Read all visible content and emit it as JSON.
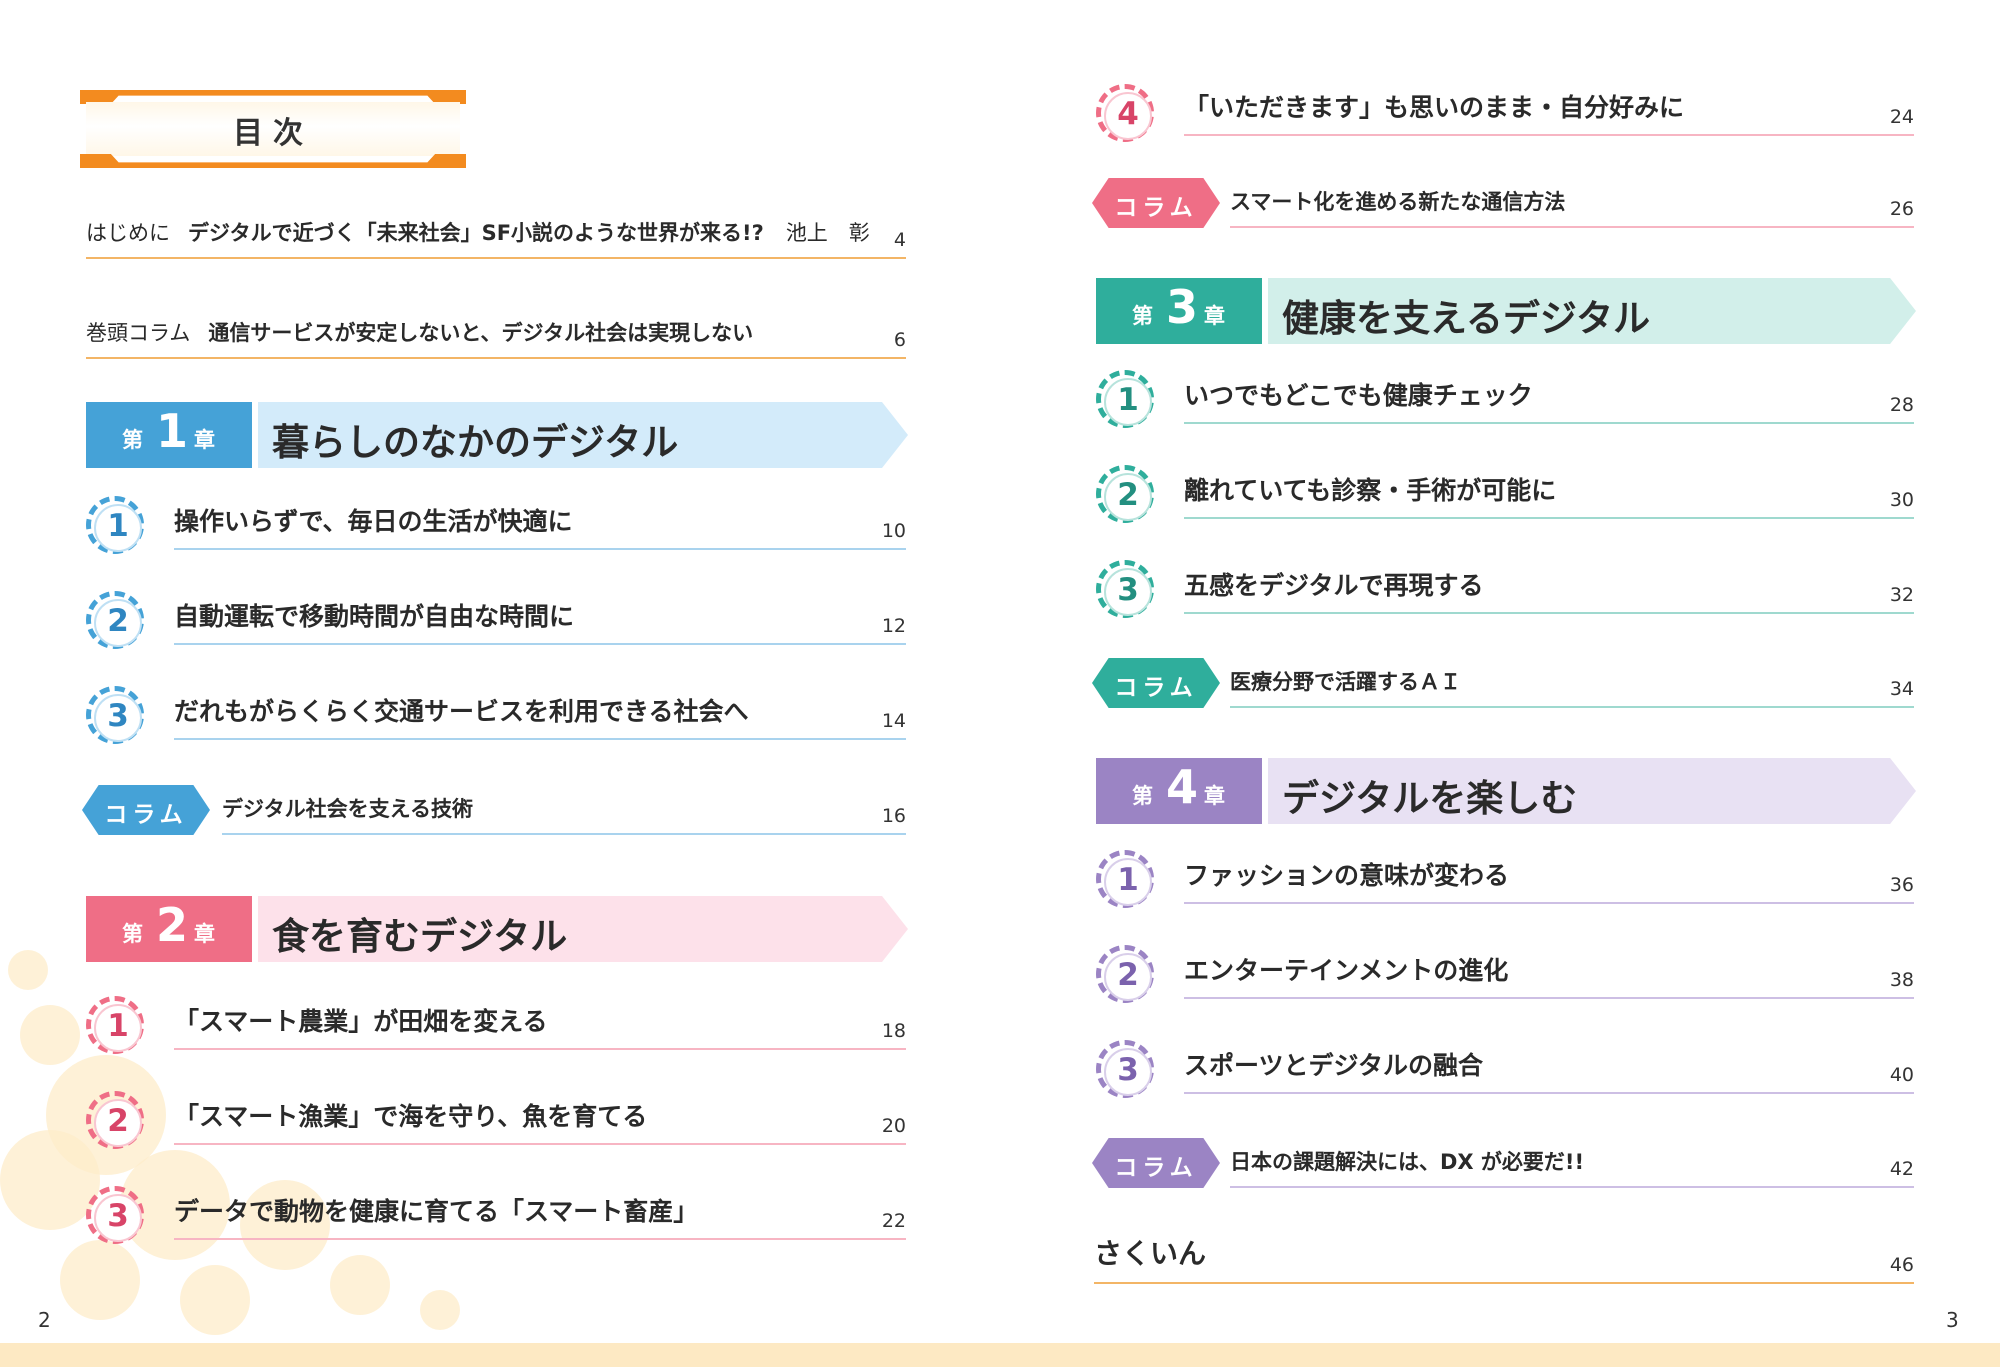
{
  "page": {
    "left_number": "2",
    "right_number": "3"
  },
  "colors": {
    "orange": "#f38b1f",
    "ch1": "#45a2d7",
    "ch1_band": "#d3ebfa",
    "ch2": "#ef6e86",
    "ch2_band": "#fde1ea",
    "ch3": "#2fae9c",
    "ch3_band": "#d2efea",
    "ch4": "#9b84c4",
    "ch4_band": "#e8e1f3",
    "pink_accent": "#d84468"
  },
  "title": "目次",
  "intro": [
    {
      "prefix": "はじめに",
      "text": "デジタルで近づく「未来社会」SF小説のような世界が来る!?",
      "author": "池上　彰",
      "page": "4"
    },
    {
      "prefix": "巻頭コラム",
      "text": "通信サービスが安定しないと、デジタル社会は実現しない",
      "author": "",
      "page": "6"
    }
  ],
  "chapters": [
    {
      "dai": "第",
      "num": "1",
      "sho": "章",
      "title": "暮らしのなかのデジタル",
      "items": [
        {
          "num": "1",
          "text": "操作いらずで、毎日の生活が快適に",
          "page": "10"
        },
        {
          "num": "2",
          "text": "自動運転で移動時間が自由な時間に",
          "page": "12"
        },
        {
          "num": "3",
          "text": "だれもがらくらく交通サービスを利用できる社会へ",
          "page": "14"
        }
      ],
      "column": {
        "tag": "コラム",
        "text": "デジタル社会を支える技術",
        "page": "16"
      }
    },
    {
      "dai": "第",
      "num": "2",
      "sho": "章",
      "title": "食を育むデジタル",
      "items": [
        {
          "num": "1",
          "text": "「スマート農業」が田畑を変える",
          "page": "18"
        },
        {
          "num": "2",
          "text": "「スマート漁業」で海を守り、魚を育てる",
          "page": "20"
        },
        {
          "num": "3",
          "text": "データで動物を健康に育てる「スマート畜産」",
          "page": "22"
        },
        {
          "num": "4",
          "text": "「いただきます」も思いのまま・自分好みに",
          "page": "24"
        }
      ],
      "column": {
        "tag": "コラム",
        "text": "スマート化を進める新たな通信方法",
        "page": "26"
      }
    },
    {
      "dai": "第",
      "num": "3",
      "sho": "章",
      "title": "健康を支えるデジタル",
      "items": [
        {
          "num": "1",
          "text": "いつでもどこでも健康チェック",
          "page": "28"
        },
        {
          "num": "2",
          "text": "離れていても診察・手術が可能に",
          "page": "30"
        },
        {
          "num": "3",
          "text": "五感をデジタルで再現する",
          "page": "32"
        }
      ],
      "column": {
        "tag": "コラム",
        "text": "医療分野で活躍するＡＩ",
        "page": "34"
      }
    },
    {
      "dai": "第",
      "num": "4",
      "sho": "章",
      "title": "デジタルを楽しむ",
      "items": [
        {
          "num": "1",
          "text": "ファッションの意味が変わる",
          "page": "36"
        },
        {
          "num": "2",
          "text": "エンターテインメントの進化",
          "page": "38"
        },
        {
          "num": "3",
          "text": "スポーツとデジタルの融合",
          "page": "40"
        }
      ],
      "column": {
        "tag": "コラム",
        "text": "日本の課題解決には、DX が必要だ!!",
        "page": "42"
      }
    }
  ],
  "index": {
    "text": "さくいん",
    "page": "46"
  }
}
